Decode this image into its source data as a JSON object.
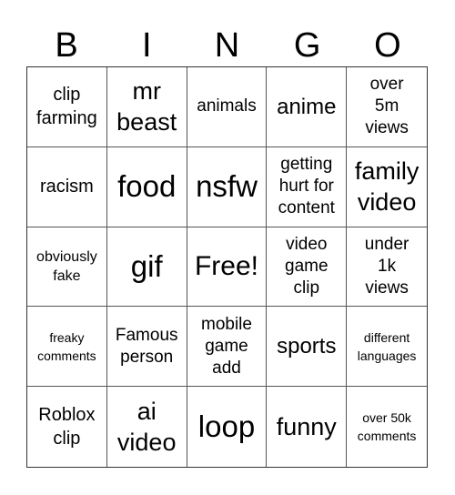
{
  "header": {
    "letters": [
      "B",
      "I",
      "N",
      "G",
      "O"
    ]
  },
  "board": {
    "cells": [
      "clip farming",
      "mr beast",
      "animals",
      "anime",
      "over 5m views",
      "racism",
      "food",
      "nsfw",
      "getting hurt for content",
      "family video",
      "obviously fake",
      "gif",
      "Free!",
      "video game clip",
      "under 1k views",
      "freaky comments",
      "Famous person",
      "mobile game add",
      "sports",
      "different languages",
      "Roblox clip",
      "ai video",
      "loop",
      "funny",
      "over 50k comments"
    ],
    "free_space_index": 12
  }
}
